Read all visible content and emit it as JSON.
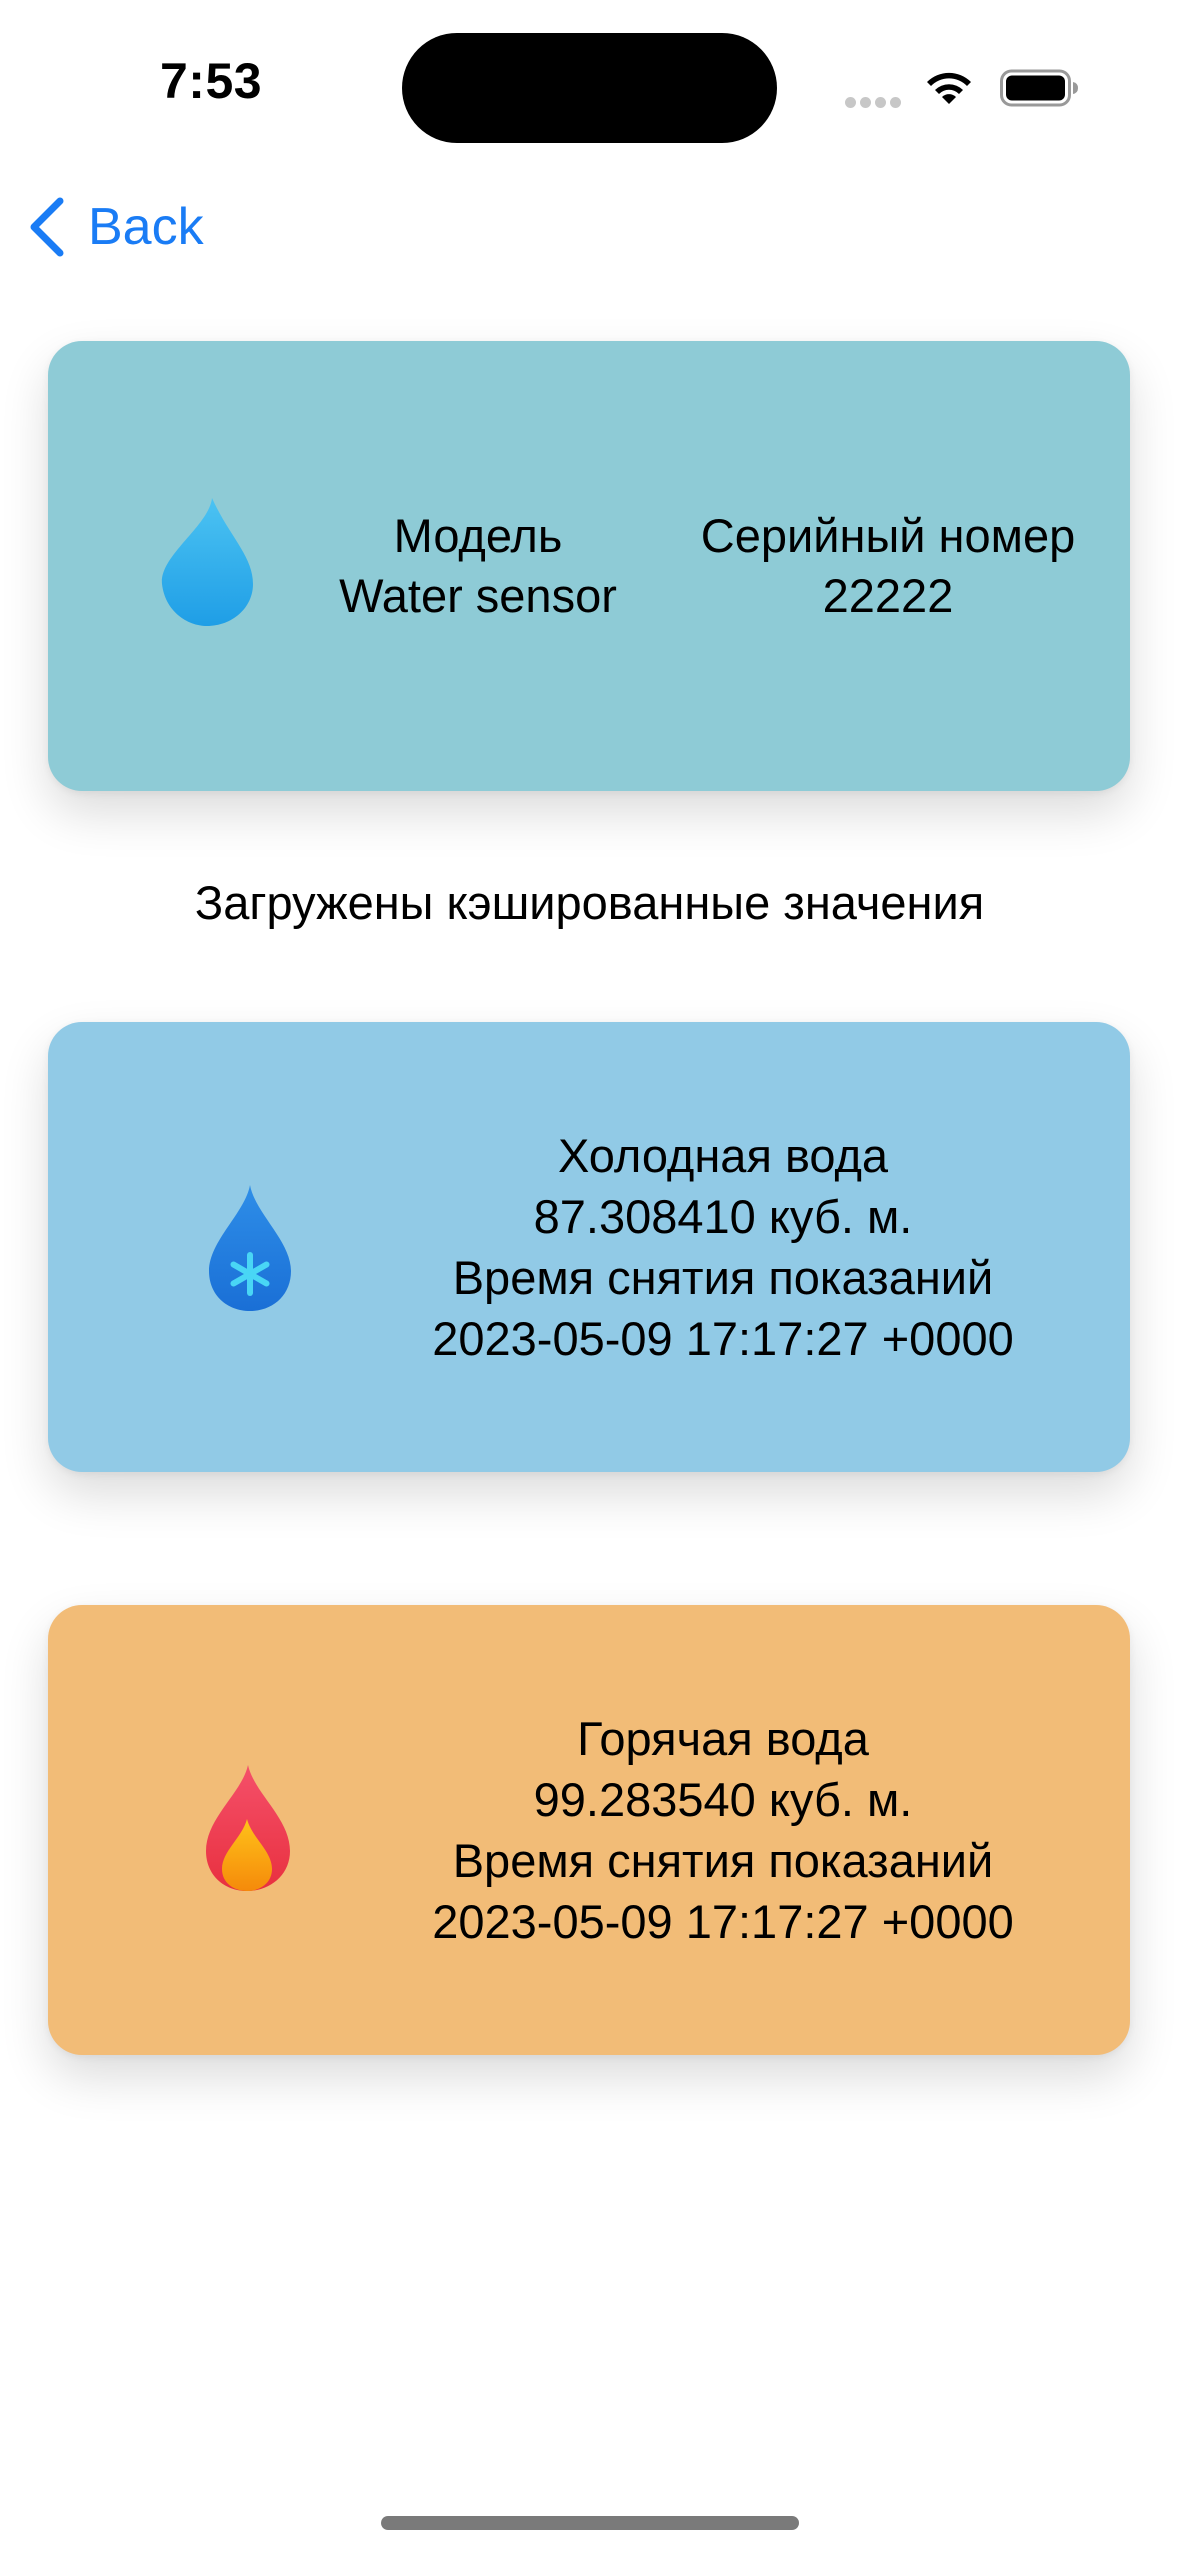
{
  "status_bar": {
    "time": "7:53"
  },
  "nav": {
    "back_label": "Back"
  },
  "device_card": {
    "icon": "water-drop-icon",
    "model_label": "Модель",
    "model_value": "Water sensor",
    "serial_label": "Серийный номер",
    "serial_value": "22222"
  },
  "cache_status": "Загружены кэшированные значения",
  "cold_water": {
    "icon": "snowflake-drop-icon",
    "title": "Холодная вода",
    "value": "87.308410 куб. м.",
    "time_label": "Время снятия показаний",
    "timestamp": "2023-05-09 17:17:27 +0000",
    "color": "#91cae6"
  },
  "hot_water": {
    "icon": "flame-icon",
    "title": "Горячая вода",
    "value": "99.283540 куб. м.",
    "time_label": "Время снятия показаний",
    "timestamp": "2023-05-09 17:17:27 +0000",
    "color": "#f2bc77"
  },
  "colors": {
    "accent": "#1a7cf5",
    "device_card": "#8ecbd6"
  }
}
